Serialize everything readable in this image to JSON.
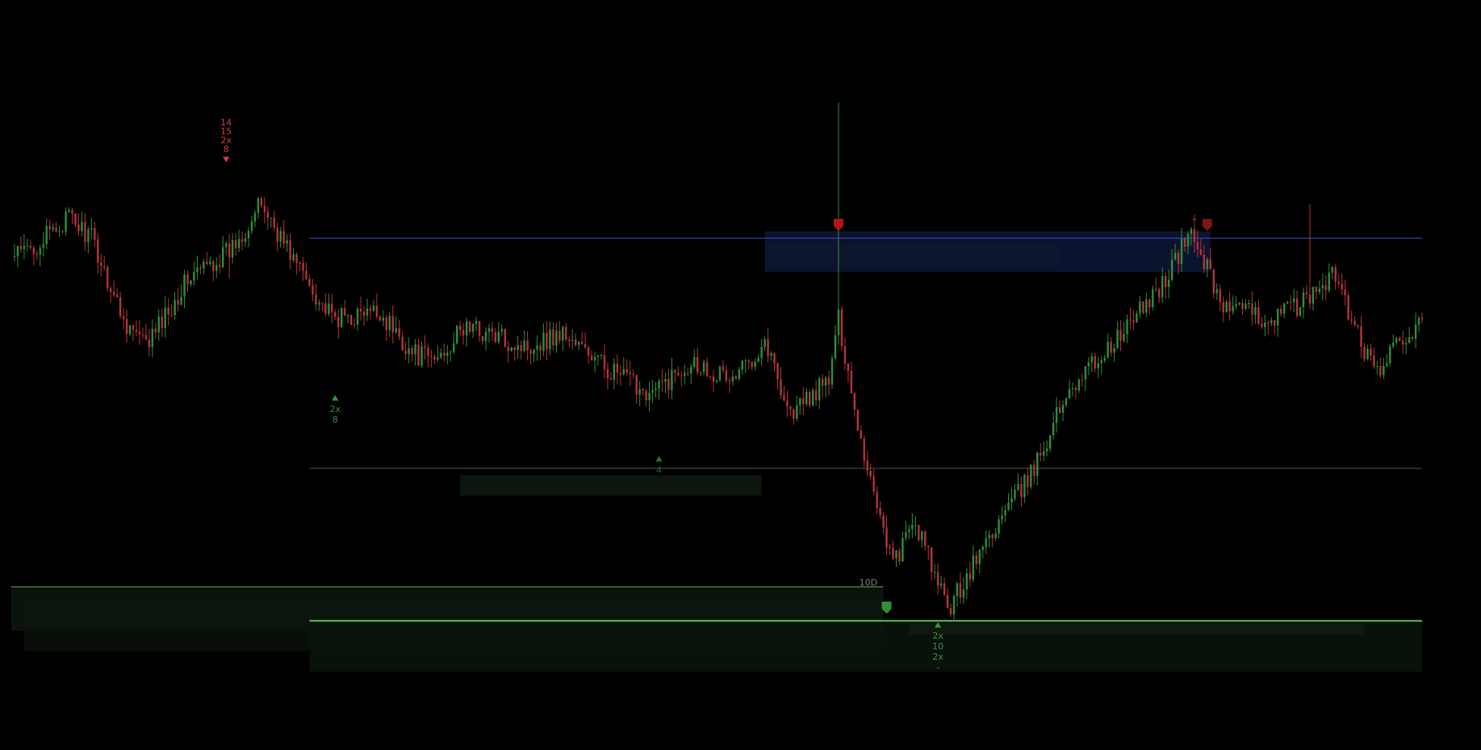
{
  "chart_data": {
    "type": "candlestick",
    "theme": {
      "background": "#000000",
      "up_color": "#2f8f3a",
      "down_color": "#b5343a"
    },
    "price_axis": {
      "visible": false,
      "ylim": [
        0,
        100
      ]
    },
    "time_axis": {
      "visible": false,
      "bars": 440
    },
    "anchors": [
      {
        "i": 0,
        "p": 69
      },
      {
        "i": 8,
        "p": 71
      },
      {
        "i": 18,
        "p": 75
      },
      {
        "i": 25,
        "p": 72
      },
      {
        "i": 35,
        "p": 60
      },
      {
        "i": 42,
        "p": 56
      },
      {
        "i": 55,
        "p": 66
      },
      {
        "i": 68,
        "p": 70
      },
      {
        "i": 78,
        "p": 77
      },
      {
        "i": 88,
        "p": 69
      },
      {
        "i": 100,
        "p": 60
      },
      {
        "i": 115,
        "p": 61
      },
      {
        "i": 125,
        "p": 55
      },
      {
        "i": 132,
        "p": 54
      },
      {
        "i": 142,
        "p": 59
      },
      {
        "i": 160,
        "p": 56
      },
      {
        "i": 172,
        "p": 58
      },
      {
        "i": 185,
        "p": 53
      },
      {
        "i": 200,
        "p": 49
      },
      {
        "i": 212,
        "p": 54
      },
      {
        "i": 225,
        "p": 51
      },
      {
        "i": 235,
        "p": 57
      },
      {
        "i": 243,
        "p": 46
      },
      {
        "i": 255,
        "p": 51
      },
      {
        "i": 258,
        "p": 60
      },
      {
        "i": 265,
        "p": 42
      },
      {
        "i": 275,
        "p": 24
      },
      {
        "i": 282,
        "p": 30
      },
      {
        "i": 292,
        "p": 17
      },
      {
        "i": 305,
        "p": 28
      },
      {
        "i": 318,
        "p": 37
      },
      {
        "i": 330,
        "p": 50
      },
      {
        "i": 345,
        "p": 57
      },
      {
        "i": 360,
        "p": 66
      },
      {
        "i": 368,
        "p": 73
      },
      {
        "i": 378,
        "p": 62
      },
      {
        "i": 392,
        "p": 60
      },
      {
        "i": 405,
        "p": 63
      },
      {
        "i": 412,
        "p": 67
      },
      {
        "i": 425,
        "p": 52
      },
      {
        "i": 440,
        "p": 60
      }
    ],
    "spikes": [
      {
        "i": 258,
        "high": 92
      },
      {
        "i": 68,
        "low": 66
      },
      {
        "i": 405,
        "high": 77
      }
    ],
    "levels": [
      {
        "name": "resistance",
        "price": 72,
        "color": "#3a4fd0",
        "from": 93,
        "to": 440
      },
      {
        "name": "mid",
        "price": 38,
        "color": "#4a5548",
        "from": 93,
        "to": 440
      },
      {
        "name": "support-10d",
        "price": 20.5,
        "color": "#6aa56f",
        "from": 0,
        "to": 272,
        "label": "10D"
      },
      {
        "name": "support",
        "price": 15.5,
        "color": "#55c24f",
        "from": 93,
        "to": 440
      }
    ],
    "zones": [
      {
        "color": "#0d1533",
        "from": 235,
        "to": 374,
        "top": 73,
        "bottom": 67,
        "opacity": 0.9
      },
      {
        "color": "#101830",
        "from": 235,
        "to": 327,
        "top": 71,
        "bottom": 68,
        "opacity": 0.6
      },
      {
        "color": "#0c1a10",
        "from": 140,
        "to": 234,
        "top": 37,
        "bottom": 34,
        "opacity": 0.9
      },
      {
        "color": "#0c160c",
        "from": 0,
        "to": 272,
        "top": 20.5,
        "bottom": 14,
        "opacity": 0.9
      },
      {
        "color": "#0c160c",
        "from": 4,
        "to": 272,
        "top": 18,
        "bottom": 11,
        "opacity": 0.7
      },
      {
        "color": "#0a140a",
        "from": 93,
        "to": 440,
        "top": 15.5,
        "bottom": 8,
        "opacity": 0.9
      },
      {
        "color": "#121c12",
        "from": 280,
        "to": 422,
        "top": 15,
        "bottom": 13.5,
        "opacity": 0.8
      }
    ],
    "markers": [
      {
        "i": 67,
        "p": 84,
        "side": "sell",
        "color": "#d1423f",
        "texts": [
          "8",
          "2x",
          "15",
          "14"
        ]
      },
      {
        "i": 101,
        "p": 48,
        "side": "buy",
        "color": "#3b8f43",
        "texts": [
          "2x",
          "8"
        ]
      },
      {
        "i": 202,
        "p": 39,
        "side": "buy",
        "color": "#2e6f34",
        "texts": [
          "4"
        ]
      },
      {
        "i": 289,
        "p": 14.5,
        "side": "buy",
        "color": "#3b8f43",
        "texts": [
          "2x",
          "10",
          "2x",
          "-"
        ]
      }
    ],
    "shields": [
      {
        "i": 258,
        "p": 74,
        "color": "#b01818"
      },
      {
        "i": 373,
        "p": 74,
        "color": "#7a1818"
      },
      {
        "i": 273,
        "p": 17.5,
        "color": "#2f8f3a"
      }
    ],
    "small_arrow": {
      "i": 369,
      "p": 74.5,
      "color": "#b5343a",
      "text": "↓"
    }
  }
}
